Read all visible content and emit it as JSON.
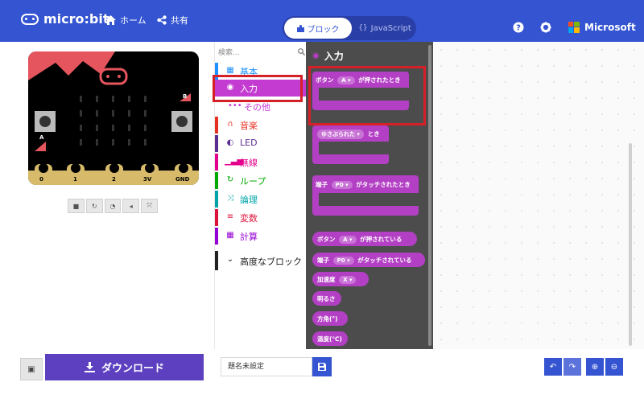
{
  "app": {
    "logo_text": "micro:bit",
    "brand": "#3454d1"
  },
  "header": {
    "home_label": "ホーム",
    "share_label": "共有",
    "blocks_label": "ブロック",
    "javascript_label": "JavaScript",
    "microsoft_label": "Microsoft"
  },
  "simulator": {
    "pins": [
      "0",
      "1",
      "2",
      "3V",
      "GND"
    ],
    "button_a": "A",
    "button_b": "B"
  },
  "categories": {
    "search_placeholder": "検索...",
    "items": [
      {
        "label": "基本",
        "color": "#1e90ff",
        "icon": "grid-icon"
      },
      {
        "label": "入力",
        "color": "#c43bd1",
        "icon": "radio-icon"
      },
      {
        "label": "その他",
        "color": "#c43bd1",
        "icon": "more-icon"
      },
      {
        "label": "音楽",
        "color": "#e63022",
        "icon": "headphones-icon"
      },
      {
        "label": "LED",
        "color": "#5c2d91",
        "icon": "toggle-icon"
      },
      {
        "label": "無線",
        "color": "#e3008c",
        "icon": "signal-icon"
      },
      {
        "label": "ループ",
        "color": "#00aa00",
        "icon": "loop-icon"
      },
      {
        "label": "論理",
        "color": "#00a4a6",
        "icon": "shuffle-icon"
      },
      {
        "label": "変数",
        "color": "#dc143c",
        "icon": "list-icon"
      },
      {
        "label": "計算",
        "color": "#9400d3",
        "icon": "calculator-icon"
      }
    ],
    "advanced_label": "高度なブロック"
  },
  "flyout": {
    "title": "入力",
    "color": "#b340c4",
    "blocks": {
      "button_pressed": {
        "prefix": "ボタン",
        "dropdown": "A",
        "suffix": "が押されたとき"
      },
      "shake": {
        "dropdown": "ゆさぶられた",
        "suffix": "とき"
      },
      "pin_pressed": {
        "prefix": "端子",
        "dropdown": "P0",
        "suffix": "がタッチされたとき"
      },
      "is_button_pressed": {
        "prefix": "ボタン",
        "dropdown": "A",
        "suffix": "が押されている"
      },
      "is_pin_pressed": {
        "prefix": "端子",
        "dropdown": "P0",
        "suffix": "がタッチされている"
      },
      "acceleration": {
        "prefix": "加速度",
        "dropdown": "X"
      },
      "light": {
        "label": "明るさ"
      },
      "compass": {
        "label": "方角(°)"
      },
      "temperature": {
        "label": "温度(℃)"
      }
    }
  },
  "footer": {
    "download_label": "ダウンロード",
    "project_name": "題名未設定"
  },
  "highlight_color": "#d62028"
}
